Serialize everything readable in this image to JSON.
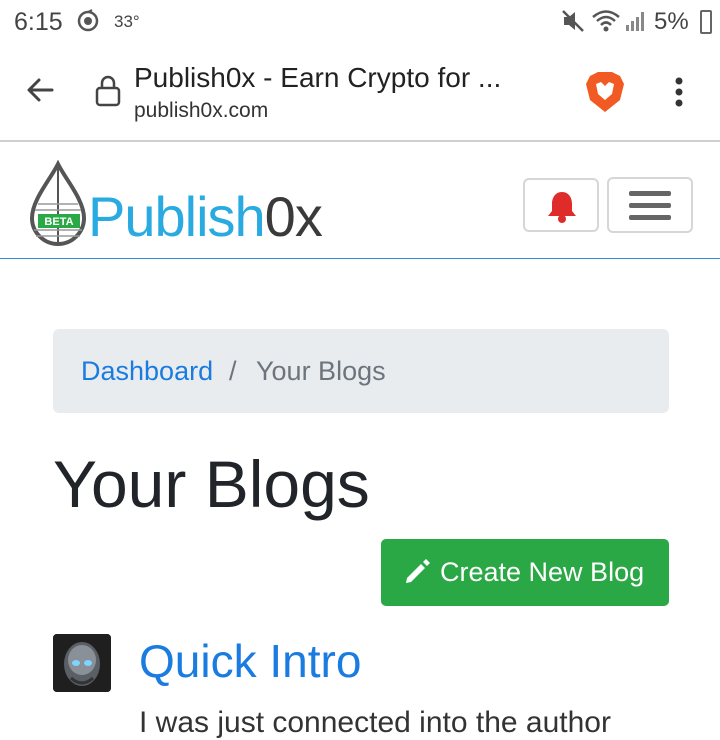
{
  "status_bar": {
    "time": "6:15",
    "temperature": "33°",
    "battery": "5%",
    "icons": [
      "sync-icon",
      "mute-icon",
      "wifi-icon",
      "signal-icon",
      "battery-icon"
    ]
  },
  "browser": {
    "page_title": "Publish0x - Earn Crypto for ...",
    "host": "publish0x.com",
    "icons": [
      "back-arrow-icon",
      "lock-icon",
      "brave-lion-icon",
      "more-vert-icon"
    ]
  },
  "site_header": {
    "logo_badge": "BETA",
    "logo_text_primary": "Publish",
    "logo_text_secondary": "0x",
    "icons": [
      "notification-bell-icon",
      "hamburger-menu-icon"
    ]
  },
  "breadcrumb": {
    "link": "Dashboard",
    "separator": "/",
    "current": "Your Blogs"
  },
  "page": {
    "title": "Your Blogs",
    "create_button": "Create New Blog"
  },
  "blogs": [
    {
      "title": "Quick Intro",
      "excerpt": "I was just connected into the author"
    }
  ],
  "colors": {
    "link_blue": "#1a7be0",
    "create_green": "#2aa845",
    "bell_red": "#e02b2b",
    "logo_blue": "#29aae1"
  }
}
